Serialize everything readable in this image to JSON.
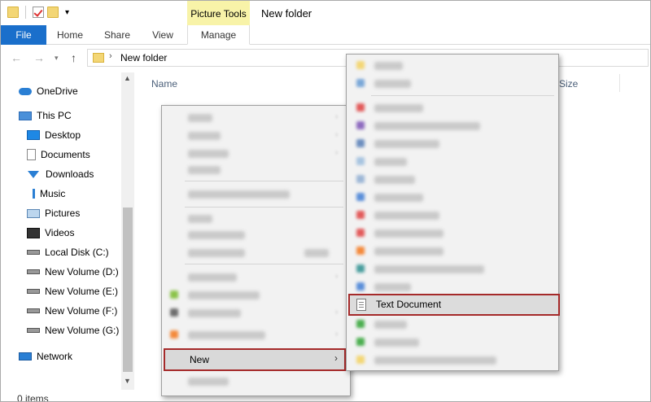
{
  "window": {
    "title": "New folder"
  },
  "ribbon": {
    "contextual_group": "Picture Tools",
    "tabs": [
      "File",
      "Home",
      "Share",
      "View",
      "Manage"
    ]
  },
  "address": {
    "path": "New folder"
  },
  "nav_pane": {
    "items": [
      {
        "label": "OneDrive",
        "icon": "onedrive-icon"
      },
      {
        "label": "This PC",
        "icon": "pc-icon"
      },
      {
        "label": "Desktop",
        "icon": "desktop-icon"
      },
      {
        "label": "Documents",
        "icon": "documents-icon"
      },
      {
        "label": "Downloads",
        "icon": "downloads-icon"
      },
      {
        "label": "Music",
        "icon": "music-icon"
      },
      {
        "label": "Pictures",
        "icon": "pictures-icon"
      },
      {
        "label": "Videos",
        "icon": "videos-icon"
      },
      {
        "label": "Local Disk (C:)",
        "icon": "disk-icon"
      },
      {
        "label": "New Volume (D:)",
        "icon": "disk-icon"
      },
      {
        "label": "New Volume (E:)",
        "icon": "disk-icon"
      },
      {
        "label": "New Volume (F:)",
        "icon": "disk-icon"
      },
      {
        "label": "New Volume (G:)",
        "icon": "disk-icon"
      },
      {
        "label": "Network",
        "icon": "network-icon"
      }
    ]
  },
  "columns": {
    "name": "Name",
    "size": "Size"
  },
  "status": {
    "items": "0 items"
  },
  "context_menu": {
    "new_label": "New"
  },
  "new_submenu": {
    "text_document_label": "Text Document"
  },
  "colors": {
    "file_tab": "#1a6fcb",
    "picture_tools": "#f8f3a8",
    "highlight_border": "#a52a2a"
  }
}
